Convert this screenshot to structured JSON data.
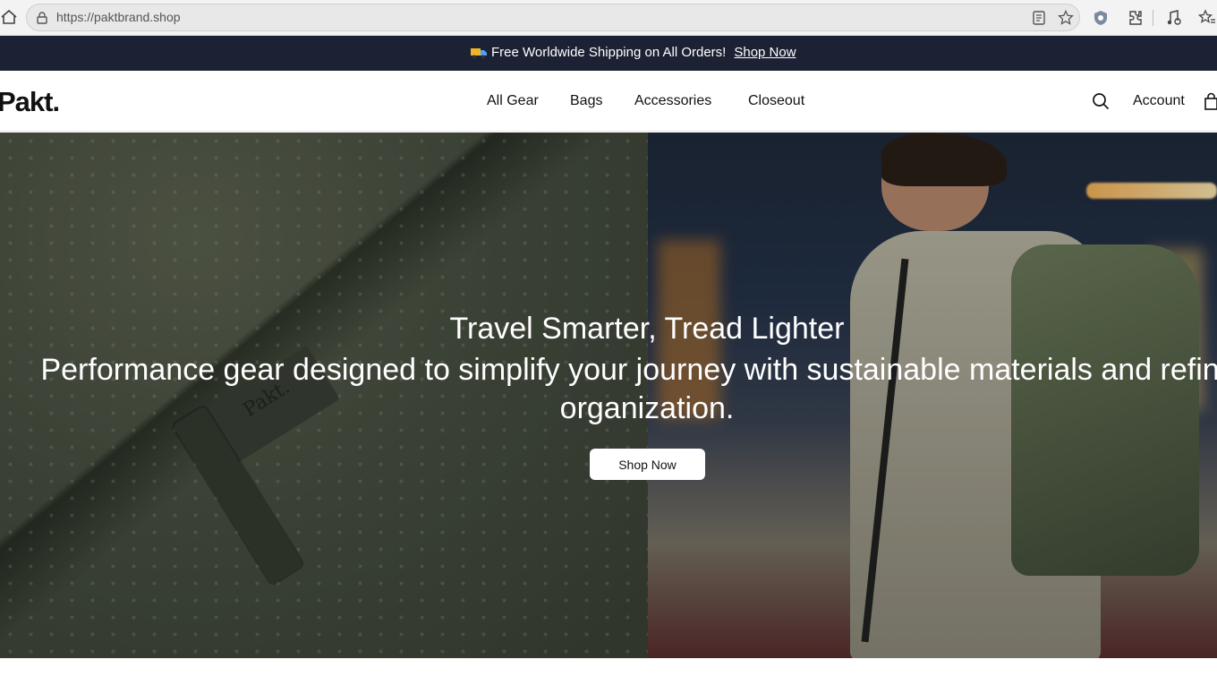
{
  "browser": {
    "url": "https://paktbrand.shop",
    "icons": [
      "home-icon",
      "lock-icon",
      "reader-mode-icon",
      "bookmark-star-icon",
      "shield-icon",
      "extensions-icon",
      "media-icon",
      "favorites-icon"
    ]
  },
  "announcement": {
    "icon": "truck-icon",
    "text": "Free Worldwide Shipping on All Orders!",
    "link_label": "Shop Now"
  },
  "header": {
    "logo": "Pakt.",
    "nav": [
      {
        "label": "All Gear"
      },
      {
        "label": "Bags"
      },
      {
        "label": "Accessories"
      },
      {
        "label": "Closeout"
      }
    ],
    "account_label": "Account",
    "icons": [
      "search-icon",
      "cart-icon"
    ]
  },
  "hero": {
    "title": "Travel Smarter, Tread Lighter",
    "subtitle": "Performance gear designed to simplify your journey with sustainable materials and refined organization.",
    "button_label": "Shop Now",
    "brand_tag": "Pakt."
  },
  "colors": {
    "announcement_bg": "#1c2134",
    "button_bg": "#ffffff",
    "text_dark": "#111111"
  }
}
